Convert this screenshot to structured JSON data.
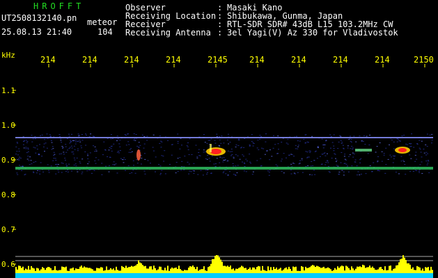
{
  "header": {
    "app_name": "HROFFT",
    "file_name": "UT2508132140.pn",
    "event_type": "meteor",
    "datetime": "25.08.13 21:40",
    "count": "104",
    "info": [
      {
        "label": "Observer",
        "value": "Masaki Kano"
      },
      {
        "label": "Receiving Location",
        "value": "Shibukawa, Gunma, Japan"
      },
      {
        "label": "Receiver",
        "value": "RTL-SDR SDR# 43dB L15 103.2MHz CW"
      },
      {
        "label": "Receiving Antenna",
        "value": "3el Yagi(V) Az 330 for Vladivostok"
      }
    ]
  },
  "axes": {
    "y_unit": "kHz",
    "x_ticks": [
      "214",
      "214",
      "214",
      "214",
      "2145",
      "214",
      "214",
      "214",
      "214",
      "2150"
    ],
    "y_ticks": [
      "1.1",
      "1.0",
      "0.9",
      "0.8",
      "0.7",
      "0.6"
    ]
  },
  "colors": {
    "background": "#000000",
    "label": "#ffff00",
    "title": "#22dd22",
    "text": "#ffffff",
    "signal_band": "#3a44c8",
    "carrier": "#33cc66",
    "echo_hot": "#ff2020",
    "echo_warm": "#ffcc00",
    "histogram": "#ffff00",
    "histogram_base": "#00ccff"
  }
}
